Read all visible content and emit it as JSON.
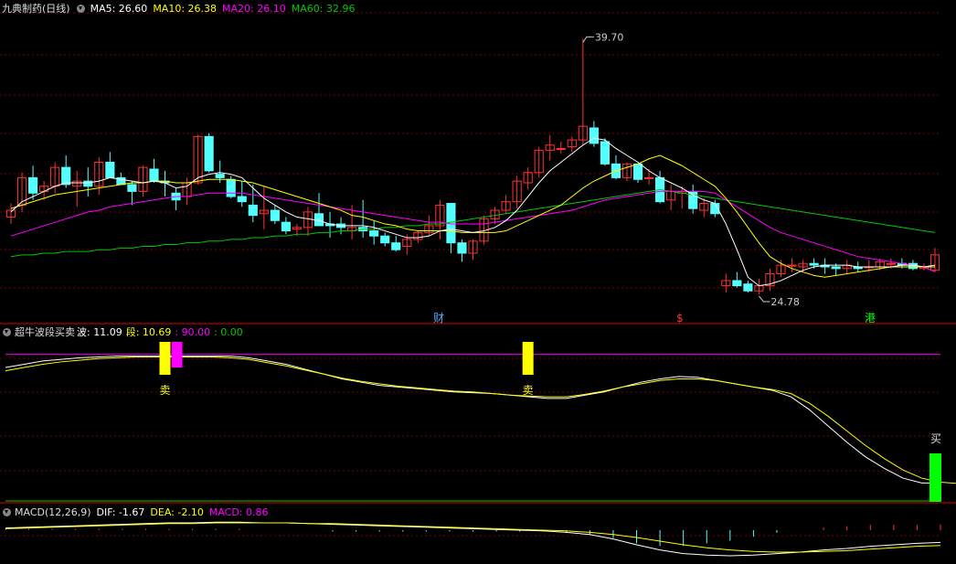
{
  "header": {
    "stock_title": "九典制药(日线)",
    "ma5": "MA5: 26.60",
    "ma10": "MA10: 26.38",
    "ma20": "MA20: 26.10",
    "ma60": "MA60: 32.96"
  },
  "price_labels": {
    "high": "39.70",
    "low": "24.78"
  },
  "markers": {
    "cai": "财",
    "xiao": "$",
    "gang": "港"
  },
  "indicator": {
    "title": "超牛波段买卖",
    "bo": "波: 11.09",
    "duan": "段: 10.69",
    "level_high": ": 90.00",
    "level_low": ": 0.00",
    "sell_label": "卖",
    "buy_label": "买"
  },
  "macd": {
    "title": "MACD(12,26,9)",
    "dif": "DIF: -1.67",
    "dea": "DEA: -2.10",
    "macd": "MACD: 0.86"
  },
  "colors": {
    "up": "#ff3232",
    "down": "#54ffff",
    "ma5": "#ffffff",
    "ma10": "#ffff00",
    "ma20": "#ff00ff",
    "ma60": "#00c800",
    "bg": "#000000",
    "grid": "#7a0000",
    "sell_signal": "#ffff00",
    "buy_signal": "#00ff00"
  },
  "chart_data": [
    {
      "type": "candlestick",
      "title": "九典制药(日线)",
      "x": [
        1,
        2,
        3,
        4,
        5,
        6,
        7,
        8,
        9,
        10,
        11,
        12,
        13,
        14,
        15,
        16,
        17,
        18,
        19,
        20,
        21,
        22,
        23,
        24,
        25,
        26,
        27,
        28,
        29,
        30,
        31,
        32,
        33,
        34,
        35,
        36,
        37,
        38,
        39,
        40,
        41,
        42,
        43,
        44,
        45,
        46,
        47,
        48,
        49,
        50,
        51,
        52,
        53,
        54,
        55,
        56,
        57,
        58,
        59,
        60,
        61,
        62,
        63,
        64,
        65,
        66,
        67,
        68,
        69,
        70,
        71,
        72,
        73,
        74,
        75,
        76,
        77,
        78,
        79,
        80,
        81,
        82,
        83,
        84,
        85
      ],
      "ohlc": [
        [
          29.3,
          30.1,
          28.9,
          29.7
        ],
        [
          30.0,
          31.9,
          29.6,
          31.6
        ],
        [
          31.6,
          32.3,
          30.3,
          30.7
        ],
        [
          30.8,
          31.4,
          30.3,
          31.1
        ],
        [
          31.1,
          32.5,
          30.7,
          32.2
        ],
        [
          32.2,
          32.9,
          31.0,
          31.2
        ],
        [
          31.1,
          32.0,
          29.9,
          31.4
        ],
        [
          31.4,
          32.2,
          30.5,
          31.1
        ],
        [
          31.1,
          32.8,
          30.6,
          32.5
        ],
        [
          32.5,
          33.1,
          31.6,
          31.6
        ],
        [
          31.6,
          31.9,
          31.2,
          31.2
        ],
        [
          31.2,
          31.4,
          30.0,
          30.8
        ],
        [
          30.8,
          32.3,
          30.5,
          32.2
        ],
        [
          32.1,
          32.7,
          31.3,
          31.4
        ],
        [
          31.4,
          32.0,
          30.5,
          31.3
        ],
        [
          30.7,
          31.0,
          29.7,
          30.3
        ],
        [
          30.5,
          31.6,
          30.0,
          31.3
        ],
        [
          31.3,
          34.1,
          31.2,
          34.0
        ],
        [
          34.0,
          34.2,
          31.9,
          32.0
        ],
        [
          31.8,
          32.6,
          31.3,
          31.6
        ],
        [
          31.5,
          31.7,
          30.4,
          30.5
        ],
        [
          30.5,
          31.4,
          29.9,
          30.2
        ],
        [
          30.0,
          31.2,
          29.0,
          29.4
        ],
        [
          29.5,
          31.1,
          28.6,
          29.7
        ],
        [
          29.7,
          30.0,
          28.9,
          29.1
        ],
        [
          29.0,
          29.3,
          28.3,
          28.5
        ],
        [
          28.6,
          28.9,
          28.2,
          28.7
        ],
        [
          28.7,
          29.9,
          28.2,
          29.6
        ],
        [
          29.5,
          30.7,
          28.8,
          28.8
        ],
        [
          28.9,
          29.6,
          28.1,
          28.8
        ],
        [
          28.9,
          29.3,
          28.3,
          28.7
        ],
        [
          28.5,
          30.0,
          28.0,
          28.7
        ],
        [
          28.7,
          30.3,
          28.1,
          28.5
        ],
        [
          28.5,
          29.1,
          27.7,
          28.2
        ],
        [
          28.2,
          28.4,
          27.6,
          27.8
        ],
        [
          27.8,
          28.2,
          27.3,
          27.4
        ],
        [
          27.6,
          28.3,
          27.1,
          28.0
        ],
        [
          28.0,
          28.5,
          27.8,
          28.4
        ],
        [
          28.4,
          29.4,
          28.2,
          28.8
        ],
        [
          28.8,
          30.3,
          28.0,
          30.0
        ],
        [
          30.1,
          30.1,
          27.2,
          27.8
        ],
        [
          27.8,
          28.0,
          26.7,
          27.2
        ],
        [
          27.2,
          28.0,
          26.8,
          27.9
        ],
        [
          27.9,
          29.4,
          27.7,
          29.2
        ],
        [
          29.2,
          29.9,
          28.9,
          29.7
        ],
        [
          29.7,
          30.6,
          29.5,
          30.2
        ],
        [
          30.2,
          31.7,
          29.8,
          31.4
        ],
        [
          31.3,
          32.2,
          30.9,
          31.9
        ],
        [
          31.9,
          33.4,
          31.6,
          33.2
        ],
        [
          33.2,
          34.1,
          32.6,
          33.5
        ],
        [
          33.3,
          33.7,
          33.0,
          33.3
        ],
        [
          33.4,
          34.0,
          33.1,
          33.8
        ],
        [
          33.8,
          39.7,
          33.5,
          34.6
        ],
        [
          34.5,
          34.9,
          33.4,
          33.6
        ],
        [
          33.7,
          33.9,
          32.3,
          32.4
        ],
        [
          32.4,
          32.9,
          31.5,
          31.6
        ],
        [
          31.6,
          32.5,
          31.4,
          32.4
        ],
        [
          32.4,
          32.4,
          31.3,
          31.5
        ],
        [
          31.6,
          32.1,
          31.2,
          31.6
        ],
        [
          31.6,
          32.0,
          30.1,
          30.2
        ],
        [
          30.3,
          31.2,
          29.7,
          30.8
        ],
        [
          30.7,
          31.1,
          29.8,
          30.8
        ],
        [
          30.8,
          31.2,
          29.5,
          29.8
        ],
        [
          29.7,
          30.4,
          29.3,
          30.1
        ],
        [
          30.1,
          30.3,
          29.3,
          29.5
        ],
        [
          25.3,
          26.0,
          24.9,
          25.6
        ],
        [
          25.6,
          26.1,
          25.2,
          25.3
        ],
        [
          25.4,
          25.6,
          24.9,
          25.0
        ],
        [
          25.0,
          25.7,
          24.8,
          25.3
        ],
        [
          25.3,
          26.3,
          25.0,
          26.0
        ],
        [
          26.0,
          26.8,
          25.8,
          26.5
        ],
        [
          26.5,
          26.9,
          26.1,
          26.5
        ],
        [
          26.4,
          26.8,
          26.1,
          26.6
        ],
        [
          26.6,
          26.9,
          26.3,
          26.5
        ],
        [
          26.5,
          26.9,
          26.0,
          26.4
        ],
        [
          26.4,
          26.6,
          25.9,
          26.3
        ],
        [
          26.3,
          26.8,
          26.0,
          26.5
        ],
        [
          26.4,
          26.7,
          26.1,
          26.3
        ],
        [
          26.4,
          26.8,
          26.1,
          26.4
        ],
        [
          26.4,
          26.9,
          26.2,
          26.7
        ],
        [
          26.6,
          26.9,
          26.3,
          26.6
        ],
        [
          26.6,
          26.9,
          26.3,
          26.5
        ],
        [
          26.6,
          26.8,
          26.2,
          26.3
        ],
        [
          26.3,
          26.6,
          26.2,
          26.4
        ],
        [
          26.2,
          27.5,
          26.1,
          27.1
        ]
      ],
      "ma5": [
        29.6,
        30.2,
        30.5,
        30.8,
        31.1,
        31.3,
        31.3,
        31.3,
        31.4,
        31.6,
        31.5,
        31.4,
        31.3,
        31.4,
        31.3,
        31.0,
        31.1,
        31.6,
        31.8,
        31.9,
        31.8,
        31.6,
        31.0,
        30.4,
        30.0,
        29.6,
        29.3,
        29.2,
        29.1,
        28.9,
        28.8,
        28.8,
        28.8,
        28.7,
        28.5,
        28.3,
        28.1,
        28.1,
        28.2,
        28.5,
        28.6,
        28.5,
        28.4,
        28.5,
        28.7,
        29.1,
        29.7,
        30.5,
        31.3,
        32.0,
        32.5,
        33.0,
        33.5,
        33.9,
        33.8,
        33.3,
        32.9,
        32.5,
        32.0,
        31.6,
        31.3,
        31.0,
        30.6,
        30.3,
        30.1,
        28.9,
        27.4,
        25.8,
        25.3,
        25.4,
        25.6,
        25.9,
        26.2,
        26.4,
        26.5,
        26.5,
        26.5,
        26.4,
        26.4,
        26.4,
        26.4,
        26.5,
        26.5,
        26.4,
        26.5
      ],
      "ma10": [
        29.8,
        30.0,
        30.2,
        30.4,
        30.6,
        30.7,
        30.8,
        30.9,
        31.0,
        31.1,
        31.2,
        31.3,
        31.3,
        31.4,
        31.4,
        31.3,
        31.3,
        31.4,
        31.5,
        31.5,
        31.5,
        31.4,
        31.3,
        31.1,
        30.9,
        30.7,
        30.5,
        30.3,
        30.1,
        29.9,
        29.7,
        29.4,
        29.3,
        29.1,
        28.9,
        28.8,
        28.6,
        28.5,
        28.5,
        28.5,
        28.5,
        28.4,
        28.4,
        28.4,
        28.4,
        28.5,
        28.8,
        29.1,
        29.4,
        29.7,
        30.0,
        30.5,
        31.0,
        31.4,
        31.7,
        32.0,
        32.2,
        32.4,
        32.7,
        32.9,
        32.6,
        32.3,
        31.9,
        31.5,
        31.1,
        30.4,
        29.6,
        28.7,
        27.8,
        27.0,
        26.6,
        26.3,
        26.1,
        25.9,
        25.8,
        25.9,
        26.0,
        26.1,
        26.2,
        26.3,
        26.4,
        26.4,
        26.4,
        26.4,
        26.4
      ],
      "ma20": [
        28.2,
        28.4,
        28.6,
        28.8,
        29.0,
        29.2,
        29.4,
        29.6,
        29.7,
        29.9,
        30.0,
        30.1,
        30.2,
        30.3,
        30.4,
        30.5,
        30.5,
        30.6,
        30.7,
        30.7,
        30.7,
        30.7,
        30.6,
        30.5,
        30.4,
        30.3,
        30.2,
        30.1,
        30.0,
        29.9,
        29.8,
        29.7,
        29.6,
        29.5,
        29.4,
        29.3,
        29.2,
        29.1,
        29.0,
        29.0,
        28.9,
        28.9,
        28.9,
        28.9,
        29.0,
        29.1,
        29.2,
        29.3,
        29.4,
        29.5,
        29.6,
        29.7,
        29.9,
        30.1,
        30.3,
        30.4,
        30.5,
        30.6,
        30.7,
        30.8,
        30.8,
        30.8,
        30.8,
        30.8,
        30.7,
        30.3,
        29.9,
        29.5,
        29.1,
        28.7,
        28.4,
        28.2,
        28.0,
        27.8,
        27.6,
        27.4,
        27.2,
        27.0,
        26.9,
        26.8,
        26.7,
        26.6,
        26.5,
        26.4,
        26.1
      ],
      "ma60": [
        27.0,
        27.1,
        27.1,
        27.2,
        27.2,
        27.3,
        27.3,
        27.3,
        27.4,
        27.4,
        27.5,
        27.5,
        27.6,
        27.6,
        27.7,
        27.7,
        27.8,
        27.8,
        27.9,
        27.9,
        28.0,
        28.0,
        28.1,
        28.1,
        28.2,
        28.2,
        28.3,
        28.3,
        28.4,
        28.4,
        28.5,
        28.5,
        28.6,
        28.6,
        28.7,
        28.7,
        28.8,
        28.8,
        28.9,
        28.9,
        29.0,
        29.1,
        29.2,
        29.3,
        29.4,
        29.5,
        29.6,
        29.7,
        29.8,
        29.9,
        30.0,
        30.1,
        30.2,
        30.3,
        30.4,
        30.5,
        30.6,
        30.7,
        30.8,
        30.9,
        30.8,
        30.7,
        30.6,
        30.5,
        30.4,
        30.3,
        30.2,
        30.1,
        30.0,
        29.9,
        29.8,
        29.7,
        29.6,
        29.5,
        29.4,
        29.3,
        29.2,
        29.1,
        29.0,
        28.9,
        28.8,
        28.7,
        28.6,
        28.5,
        28.4
      ],
      "ylim": [
        23.2,
        41.0
      ]
    },
    {
      "type": "line",
      "title": "超牛波段买卖",
      "series": [
        {
          "name": "波",
          "values": [
            82,
            84,
            86,
            87,
            88,
            88.5,
            89,
            89,
            89,
            89,
            89,
            89,
            89,
            88,
            86,
            84,
            81,
            78,
            75,
            73,
            71,
            70,
            69,
            68,
            67,
            66.5,
            66,
            65,
            64,
            63,
            63,
            65,
            67,
            70,
            73,
            75,
            76.5,
            76,
            74,
            72,
            70,
            68,
            64,
            56,
            46,
            36,
            27,
            20,
            14,
            11,
            11.09
          ]
        },
        {
          "name": "段",
          "values": [
            80,
            82,
            84,
            85.5,
            86.5,
            87.5,
            88,
            88.5,
            88.5,
            88.5,
            88.5,
            88.5,
            88,
            87,
            85,
            83,
            80.5,
            78,
            75.5,
            73.5,
            72,
            70.5,
            69.5,
            68.5,
            67.5,
            67,
            66,
            65,
            64.5,
            64,
            64,
            65.5,
            67.5,
            70,
            72,
            74,
            75,
            75,
            74,
            72,
            70,
            68.5,
            66,
            60,
            52,
            43,
            34,
            26,
            19,
            14,
            11.5,
            10.69
          ]
        }
      ],
      "levels": [
        90.0,
        0.0
      ],
      "signals": [
        {
          "label": "卖",
          "at": 14
        },
        {
          "label": "卖",
          "at": 47
        },
        {
          "label": "买",
          "at": 84
        }
      ],
      "ylim": [
        0,
        100
      ]
    },
    {
      "type": "bar",
      "title": "MACD(12,26,9)",
      "series": [
        {
          "name": "DIF",
          "values": [
            0.3,
            0.4,
            0.5,
            0.6,
            0.7,
            0.8,
            0.9,
            1.0,
            1.0,
            1.1,
            1.1,
            1.0,
            1.0,
            0.9,
            0.8,
            0.7,
            0.6,
            0.5,
            0.4,
            0.3,
            0.2,
            0.1,
            0.0,
            -0.1,
            -0.3,
            -0.6,
            -1.2,
            -2.0,
            -2.7,
            -3.2,
            -3.4,
            -3.5,
            -3.4,
            -3.2,
            -3.0,
            -2.7,
            -2.5,
            -2.2,
            -2.0,
            -1.8,
            -1.67
          ]
        },
        {
          "name": "DEA",
          "values": [
            0.2,
            0.3,
            0.4,
            0.5,
            0.6,
            0.7,
            0.8,
            0.9,
            0.9,
            1.0,
            1.0,
            1.0,
            1.0,
            0.9,
            0.9,
            0.8,
            0.7,
            0.6,
            0.5,
            0.4,
            0.3,
            0.2,
            0.1,
            0.0,
            -0.1,
            -0.3,
            -0.6,
            -1.0,
            -1.5,
            -2.0,
            -2.4,
            -2.7,
            -2.9,
            -3.0,
            -3.0,
            -2.9,
            -2.8,
            -2.6,
            -2.4,
            -2.2,
            -2.1
          ]
        }
      ],
      "ylim": [
        -4,
        2
      ]
    }
  ]
}
